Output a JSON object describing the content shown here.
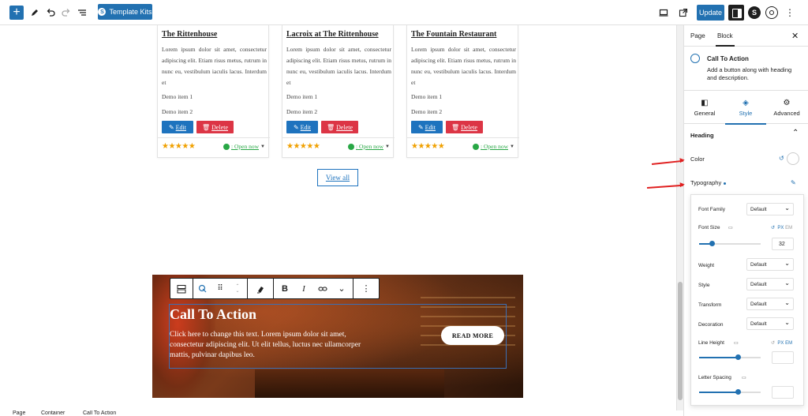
{
  "toolbar": {
    "template_kits_label": "Template Kits",
    "update_label": "Update"
  },
  "cards": [
    {
      "title": "The Rittenhouse",
      "description": "Lorem ipsum dolor sit amet, consectetur adipiscing elit. Etiam risus metus, rutrum in nunc eu, vestibulum iaculis lacus. Interdum et",
      "item1": "Demo item 1",
      "item2": "Demo item 2",
      "edit": "Edit",
      "delete": "Delete",
      "stars": "★★★★★",
      "status": ": Open now"
    },
    {
      "title": "Lacroix at The Rittenhouse",
      "description": "Lorem ipsum dolor sit amet, consectetur adipiscing elit. Etiam risus metus, rutrum in nunc eu, vestibulum iaculis lacus. Interdum et",
      "item1": "Demo item 1",
      "item2": "Demo item 2",
      "edit": "Edit",
      "delete": "Delete",
      "stars": "★★★★★",
      "status": ": Open now"
    },
    {
      "title": "The Fountain Restaurant",
      "description": "Lorem ipsum dolor sit amet, consectetur adipiscing elit. Etiam risus metus, rutrum in nunc eu, vestibulum iaculis lacus. Interdum et",
      "item1": "Demo item 1",
      "item2": "Demo item 2",
      "edit": "Edit",
      "delete": "Delete",
      "stars": "★★★★★",
      "status": ": Open now"
    }
  ],
  "view_all": "View all",
  "cta": {
    "heading": "Call To Action",
    "text": "Click here to change this text. Lorem ipsum dolor sit amet, consectetur adipiscing elit. Ut elit tellus, luctus nec ullamcorper mattis, pulvinar dapibus leo.",
    "button": "READ MORE"
  },
  "block_toolbar": {
    "bold": "B",
    "italic": "I"
  },
  "breadcrumb": [
    "Page",
    "Container",
    "Call To Action"
  ],
  "sidebar": {
    "tab_page": "Page",
    "tab_block": "Block",
    "block_title": "Call To Action",
    "block_desc": "Add a button along with heading and description.",
    "style_tabs": [
      "General",
      "Style",
      "Advanced"
    ],
    "section_heading": "Heading",
    "color_label": "Color",
    "typography_label": "Typography",
    "typography": {
      "font_family_label": "Font Family",
      "font_family_value": "Default",
      "font_size_label": "Font Size",
      "font_size_value": "32",
      "font_size_fraction": 0.2,
      "unit_px": "PX",
      "unit_em": "EM",
      "weight_label": "Weight",
      "weight_value": "Default",
      "style_label": "Style",
      "style_value": "Default",
      "transform_label": "Transform",
      "transform_value": "Default",
      "decoration_label": "Decoration",
      "decoration_value": "Default",
      "line_height_label": "Line Height",
      "letter_spacing_label": "Letter Spacing"
    }
  },
  "colors": {
    "accent": "#2271b1",
    "edit_button": "#1e73be",
    "delete_button": "#dc3545",
    "star": "#f0a000",
    "open_status": "#28a745",
    "annotation_arrow": "#e02020"
  }
}
